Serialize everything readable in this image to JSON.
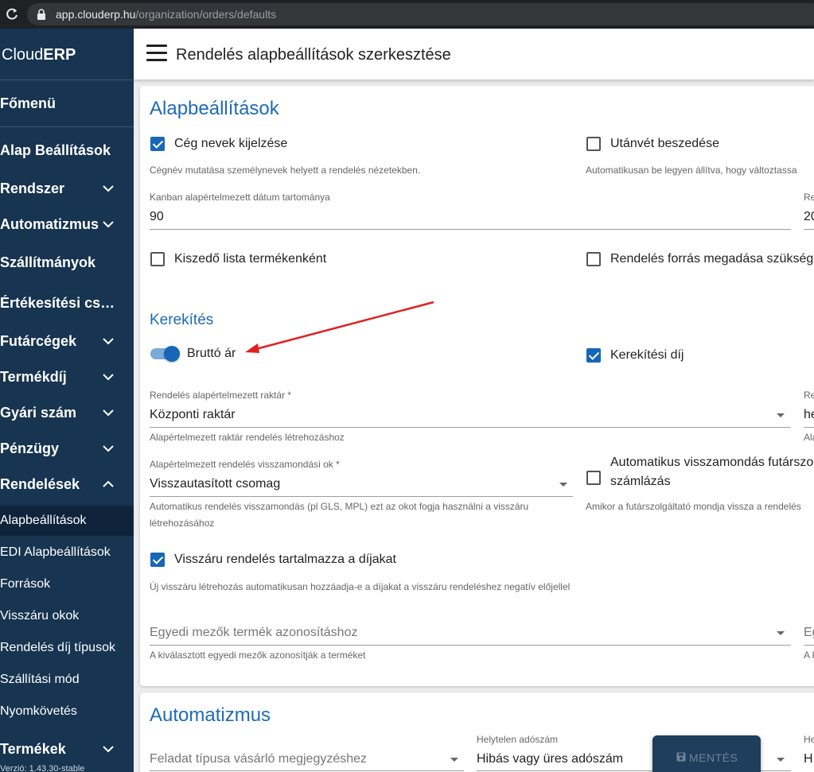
{
  "browser": {
    "domain": "app.clouderp.hu",
    "path": "/organization/orders/defaults"
  },
  "sidebar": {
    "brand_light": "Cloud",
    "brand_bold": "ERP",
    "items": [
      {
        "label": "Főmenü",
        "chevron": "none"
      },
      {
        "label": "Alap Beállítások",
        "chevron": "none"
      },
      {
        "label": "Rendszer",
        "chevron": "down"
      },
      {
        "label": "Automatizmus",
        "chevron": "down"
      },
      {
        "label": "Szállítmányok",
        "chevron": "none"
      },
      {
        "label": "Értékesítési csat…",
        "chevron": "none"
      },
      {
        "label": "Futárcégek",
        "chevron": "down"
      },
      {
        "label": "Termékdíj",
        "chevron": "down"
      },
      {
        "label": "Gyári szám",
        "chevron": "down"
      },
      {
        "label": "Pénzügy",
        "chevron": "down"
      },
      {
        "label": "Rendelések",
        "chevron": "up"
      }
    ],
    "subitems": [
      {
        "label": "Alapbeállítások",
        "active": true
      },
      {
        "label": "EDI Alapbeállítások",
        "active": false
      },
      {
        "label": "Források",
        "active": false
      },
      {
        "label": "Visszáru okok",
        "active": false
      },
      {
        "label": "Rendelés díj típusok",
        "active": false
      },
      {
        "label": "Szállítási mód",
        "active": false
      },
      {
        "label": "Nyomkövetés",
        "active": false
      }
    ],
    "bottom_item": {
      "label": "Termékek",
      "chevron": "down"
    },
    "footer": "Verzió: 1.43.30-stable"
  },
  "header": {
    "title": "Rendelés alapbeállítások szerkesztése"
  },
  "basic": {
    "title": "Alapbeállítások",
    "company_names": {
      "label": "Cég nevek kijelzése",
      "checked": true,
      "hint": "Cégnév mutatása személynevek helyett a rendelés nézetekben."
    },
    "cod_collection": {
      "label": "Utánvét beszedése",
      "checked": false,
      "hint": "Automatikusan be legyen állítva, hogy változtassa"
    },
    "kanban_range": {
      "label": "Kanban alapértelmezett dátum tartománya",
      "value": "90"
    },
    "right_field_1": {
      "label": "Re",
      "value": "20"
    },
    "picking_list": {
      "label": "Kiszedő lista termékenként",
      "checked": false
    },
    "order_source": {
      "label": "Rendelés forrás megadása szükség",
      "checked": false
    },
    "rounding_title": "Kerekítés",
    "gross_price": {
      "label": "Bruttó ár",
      "on": true
    },
    "rounding_fee": {
      "label": "Kerekítési díj",
      "checked": true
    },
    "warehouse": {
      "label": "Rendelés alapértelmezett raktár *",
      "value": "Központi raktár",
      "hint": "Alapértelmezett raktár rendelés létrehozáshoz"
    },
    "right_field_2": {
      "label": "Re",
      "value": "he",
      "hint": "Ala"
    },
    "return_reason": {
      "label": "Alapértelmezett rendelés visszamondási ok *",
      "value": "Visszautasított csomag",
      "hint_line1": "Automatikus rendelés visszamondás (pl GLS, MPL) ezt az okot fogja használni a visszáru",
      "hint_line2": "létrehozásához"
    },
    "auto_cancel": {
      "label_line1": "Automatikus visszamondás futárszo",
      "label_line2": "számlázás",
      "checked": false,
      "hint": "Amikor a futárszolgáltató mondja vissza a rendelés"
    },
    "return_fees": {
      "label": "Visszáru rendelés tartalmazza a díjakat",
      "checked": true,
      "hint": "Új visszáru létrehozás automatikusan hozzáadja-e a díjakat a visszáru rendeléshez negatív előjellel"
    },
    "custom_fields": {
      "placeholder": "Egyedi mezők termék azonosításhoz",
      "hint": "A kiválasztott egyedi mezők azonosítják a terméket"
    },
    "right_field_3": {
      "placeholder": "Eg",
      "hint": "A k"
    }
  },
  "automation": {
    "title": "Automatizmus",
    "task_type": {
      "placeholder": "Feladat típusa vásárló megjegyzéshez"
    },
    "wrong_tax": {
      "label": "Helytelen adószám",
      "value": "Hibás vagy üres adószám"
    },
    "right_field_4": {
      "label": "He",
      "value": "H"
    }
  },
  "save_button": {
    "label": "MENTÉS"
  }
}
